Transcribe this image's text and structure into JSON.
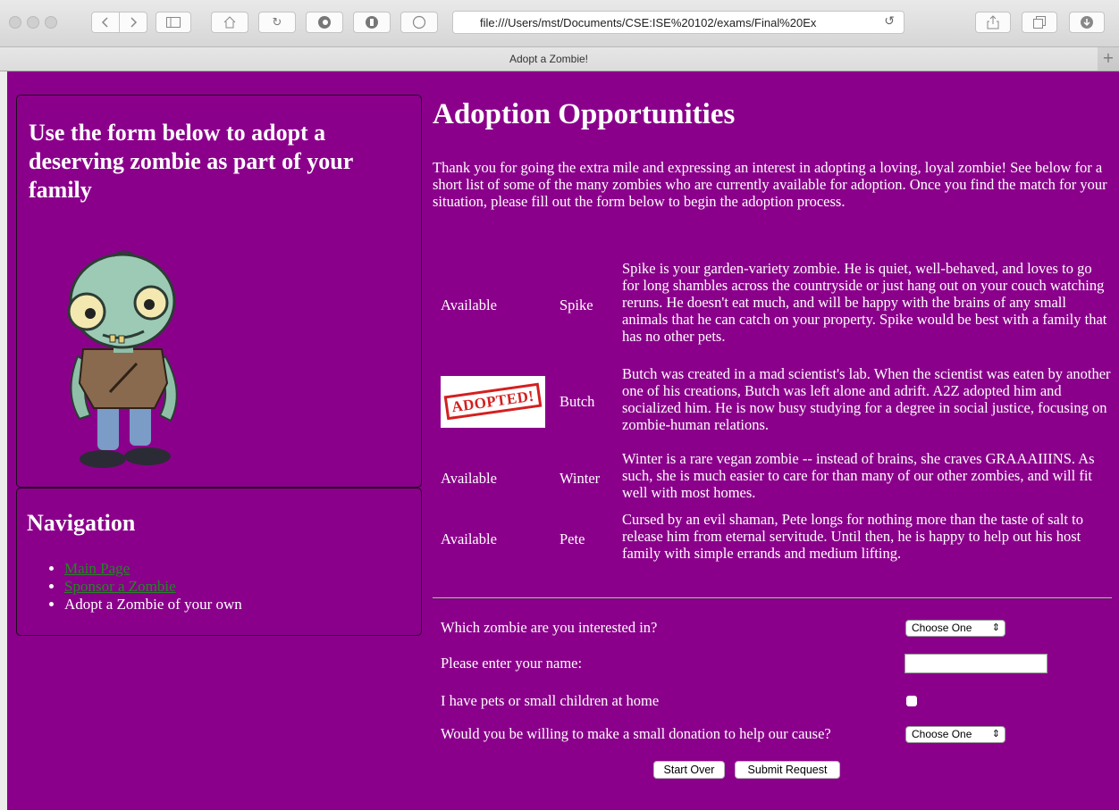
{
  "browser": {
    "url": "file:///Users/mst/Documents/CSE:ISE%20102/exams/Final%20Ex",
    "tab_title": "Adopt a Zombie!",
    "new_tab_icon": "plus-icon"
  },
  "sidebar": {
    "intro_heading": "Use the form below to adopt a deserving zombie as part of your family",
    "nav_heading": "Navigation",
    "nav_items": [
      {
        "label": "Main Page",
        "link": true
      },
      {
        "label": "Sponsor a Zombie",
        "link": true
      },
      {
        "label": "Adopt a Zombie of your own",
        "link": false
      }
    ]
  },
  "main": {
    "title": "Adoption Opportunities",
    "intro": "Thank you for going the extra mile and expressing an interest in adopting a loving, loyal zombie! See below for a short list of some of the many zombies who are currently available for adoption. Once you find the match for your situation, please fill out the form below to begin the adoption process.",
    "zombies": [
      {
        "status": "Available",
        "name": "Spike",
        "description": "Spike is your garden-variety zombie. He is quiet, well-behaved, and loves to go for long shambles across the countryside or just hang out on your couch watching reruns. He doesn't eat much, and will be happy with the brains of any small animals that he can catch on your property. Spike would be best with a family that has no other pets."
      },
      {
        "status": "ADOPTED!",
        "name": "Butch",
        "description": "Butch was created in a mad scientist's lab. When the scientist was eaten by another one of his creations, Butch was left alone and adrift. A2Z adopted him and socialized him. He is now busy studying for a degree in social justice, focusing on zombie-human relations."
      },
      {
        "status": "Available",
        "name": "Winter",
        "description": "Winter is a rare vegan zombie -- instead of brains, she craves GRAAAIIINS. As such, she is much easier to care for than many of our other zombies, and will fit well with most homes."
      },
      {
        "status": "Available",
        "name": "Pete",
        "description": "Cursed by an evil shaman, Pete longs for nothing more than the taste of salt to release him from eternal servitude. Until then, he is happy to help out his host family with simple errands and medium lifting."
      }
    ]
  },
  "form": {
    "zombie_label": "Which zombie are you interested in?",
    "zombie_select": "Choose One",
    "name_label": "Please enter your name:",
    "name_value": "",
    "pets_label": "I have pets or small children at home",
    "pets_checked": false,
    "donation_label": "Would you be willing to make a small donation to help our cause?",
    "donation_select": "Choose One",
    "reset_label": "Start Over",
    "submit_label": "Submit Request"
  }
}
